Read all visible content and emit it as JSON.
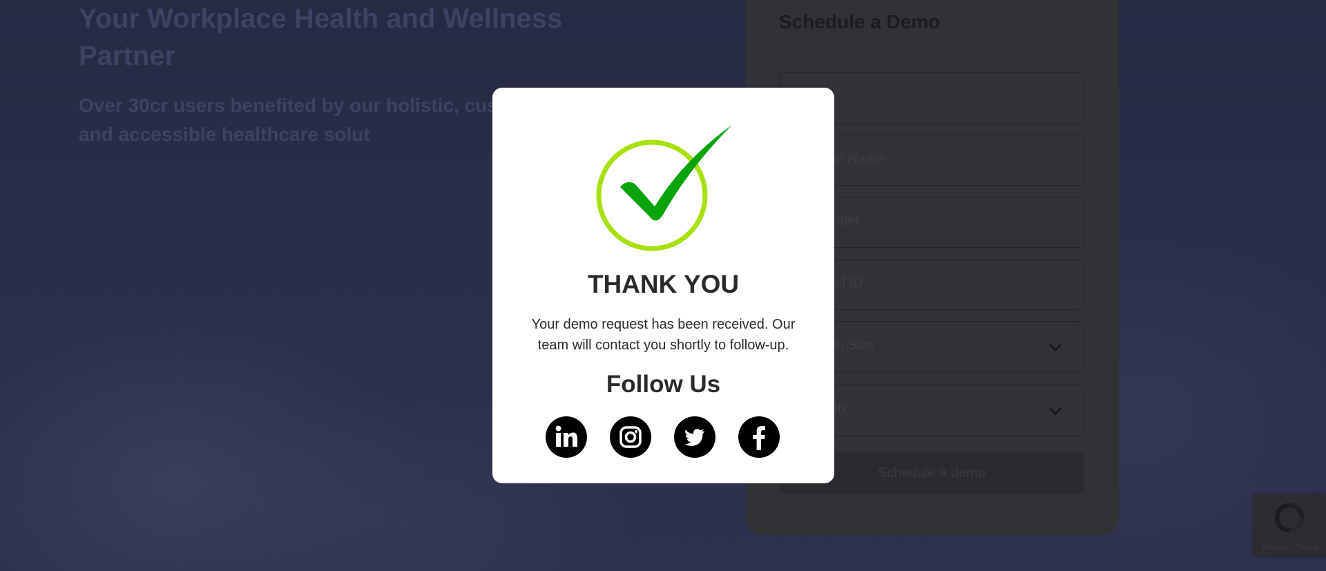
{
  "hero": {
    "title": "Your Workplace Health and Wellness Partner",
    "subtitle": "Over 30cr users benefited by our holistic, customizable and accessible healthcare solut"
  },
  "form": {
    "title": "Schedule a Demo",
    "fields": [
      {
        "placeholder": ""
      },
      {
        "placeholder": "nization Name"
      },
      {
        "placeholder": "ct Number"
      },
      {
        "placeholder": "al Email ID"
      },
      {
        "placeholder": "nization Size"
      },
      {
        "placeholder": "ested In"
      }
    ],
    "submit_label": "Schedule a demo"
  },
  "recaptcha": {
    "links": "Privacy - Terms"
  },
  "modal": {
    "title": "THANK YOU",
    "message": "Your demo request has been received. Our team will contact you shortly to follow-up.",
    "follow_label": "Follow Us",
    "socials": [
      {
        "icon": "linkedin-icon"
      },
      {
        "icon": "instagram-icon"
      },
      {
        "icon": "twitter-icon"
      },
      {
        "icon": "facebook-icon"
      }
    ],
    "accent_colors": {
      "ring": "#a7e00a",
      "check": "#09a40a"
    }
  }
}
